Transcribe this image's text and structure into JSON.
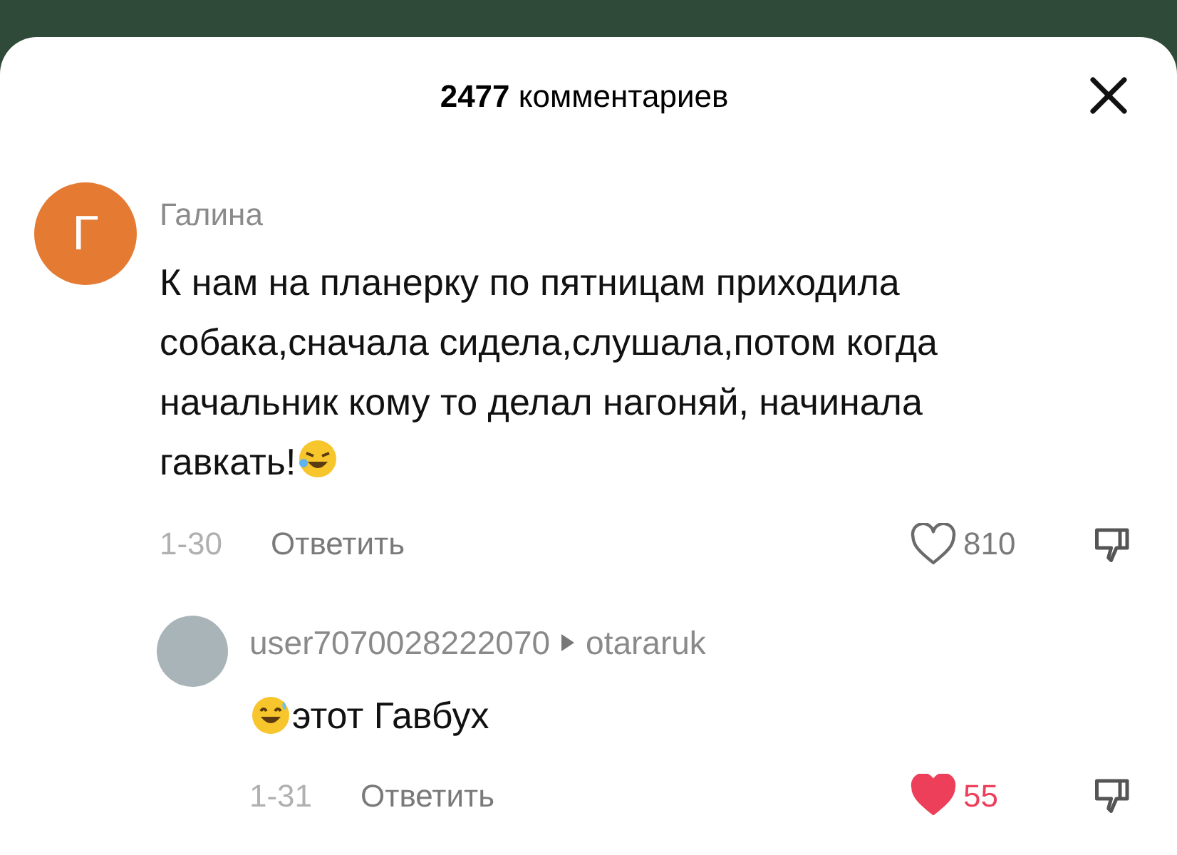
{
  "header": {
    "title_count": "2477",
    "title_text": "комментариев"
  },
  "comment": {
    "avatar_letter": "Г",
    "author": "Галина",
    "text": "К нам на планерку по пятницам приходила собака,сначала сидела,слушала,потом когда начальник кому то делал нагоняй, начинала гавкать!",
    "date": "1-30",
    "reply_label": "Ответить",
    "likes": "810",
    "liked": false
  },
  "reply": {
    "author": "user7070028222070",
    "reply_to": "otararuk",
    "text": "этот Гавбух",
    "date": "1-31",
    "reply_label": "Ответить",
    "likes": "55",
    "liked": true
  }
}
